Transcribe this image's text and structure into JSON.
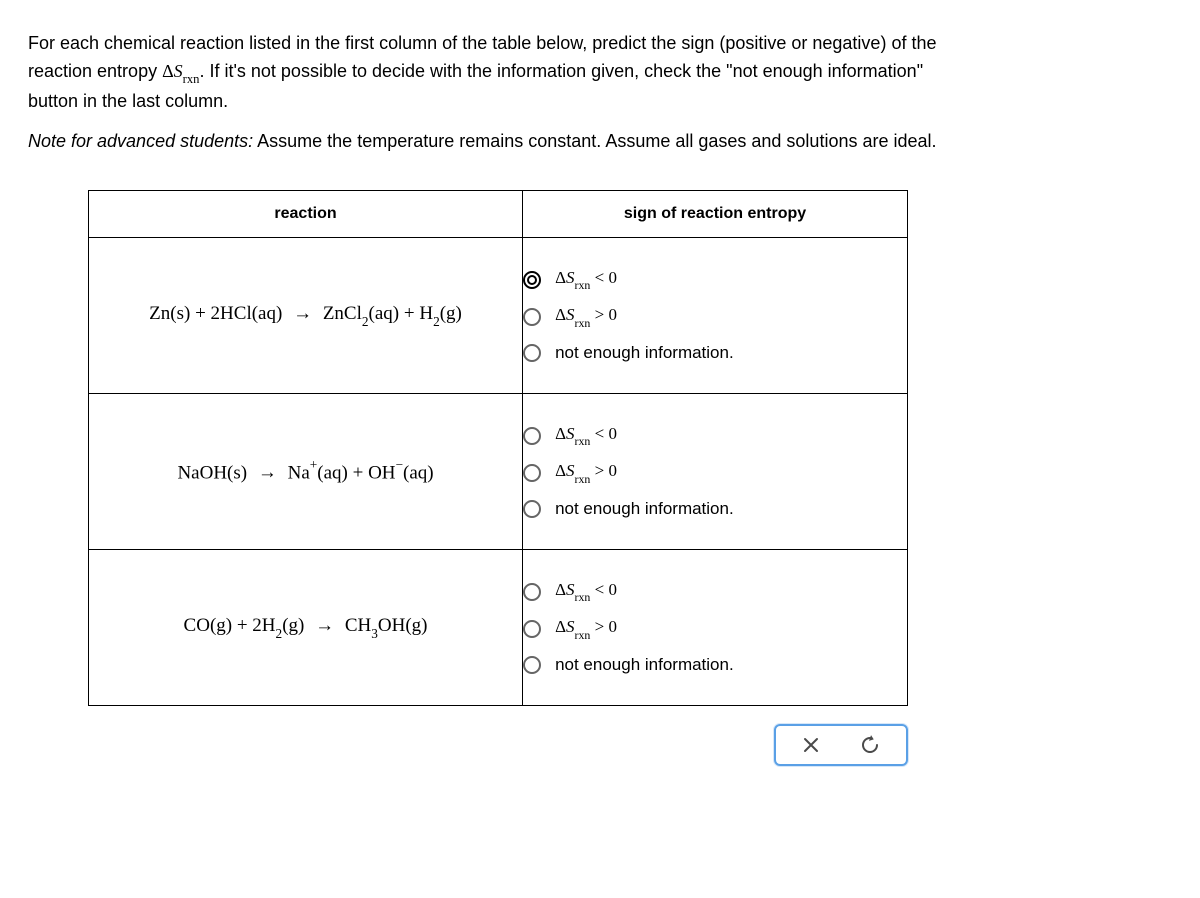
{
  "intro": {
    "line1a": "For each chemical reaction listed in the first column of the table below, predict the sign (positive or negative) of the",
    "line1b": "reaction entropy ",
    "line1c": ". If it's not possible to decide with the information given, check the \"not enough information\"",
    "line1d": "button in the last column.",
    "note_prefix": "Note for advanced students:",
    "note_rest": " Assume the temperature remains constant. Assume all gases and solutions are ideal."
  },
  "headers": {
    "reaction": "reaction",
    "sign": "sign of reaction entropy"
  },
  "options": {
    "lt": " < 0",
    "gt": " > 0",
    "nei": "not enough information."
  },
  "delta_s": {
    "delta": "Δ",
    "S": "S",
    "rxn": "rxn"
  },
  "reactions": {
    "r1": {
      "p1": "Zn",
      "s1": "(s)",
      "plus1": " + 2HCl",
      "s2": "(aq)",
      "arrow": "→",
      "p2": " ZnCl",
      "sub2": "2",
      "s3": "(aq)",
      "plus2": " + H",
      "sub3": "2",
      "s4": "(g)"
    },
    "r2": {
      "p1": "NaOH",
      "s1": "(s)",
      "arrow": "→",
      "p2": " Na",
      "sup1": "+",
      "s2": "(aq)",
      "plus1": " + OH",
      "sup2": "−",
      "s3": "(aq)"
    },
    "r3": {
      "p1": "CO",
      "s1": "(g)",
      "plus1": " + 2H",
      "sub1": "2",
      "s2": "(g)",
      "arrow": "→",
      "p2": " CH",
      "sub2": "3",
      "p3": "OH",
      "s3": "(g)"
    }
  }
}
